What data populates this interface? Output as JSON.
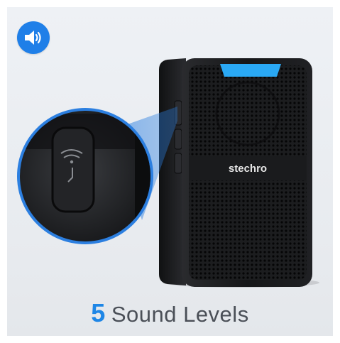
{
  "badge": {
    "icon": "speaker-volume-icon",
    "color": "#1f7fe8"
  },
  "product": {
    "brand": "stechro",
    "led_color": "#2aa9f5"
  },
  "caption": {
    "number": "5",
    "text": "Sound Levels",
    "number_color": "#1e86e6"
  }
}
